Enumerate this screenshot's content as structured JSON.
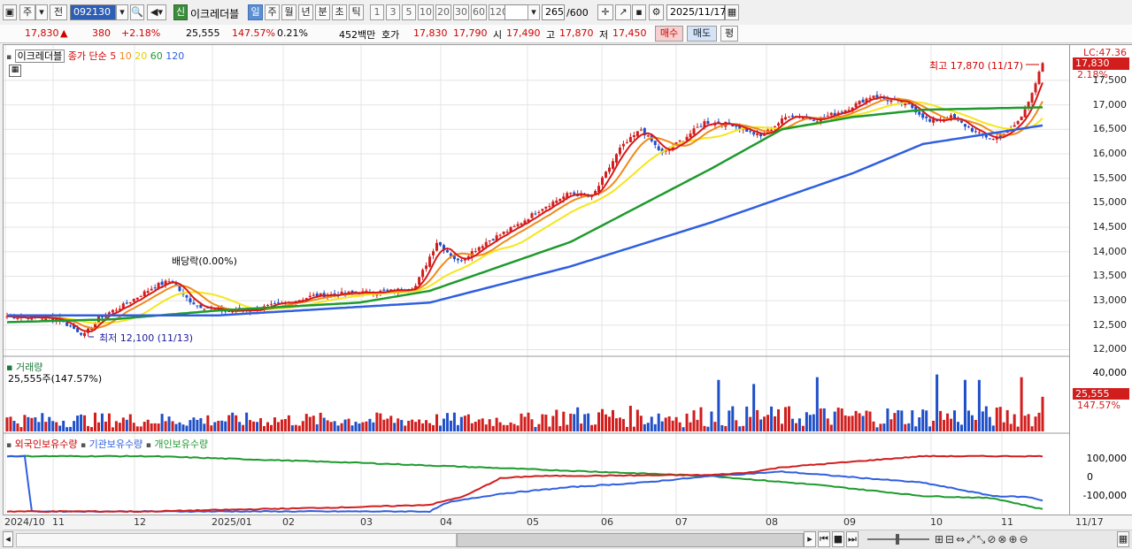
{
  "toolbar": {
    "period_day": "주",
    "prev": "전",
    "code": "092130",
    "name_tag": "신",
    "stock_name": "이크레더블",
    "tf": [
      "일",
      "주",
      "월",
      "년",
      "분",
      "초",
      "틱"
    ],
    "nums": [
      "1",
      "3",
      "5",
      "10",
      "20",
      "30",
      "60",
      "120"
    ],
    "count": "265",
    "count_max": "/600",
    "date": "2025/11/17"
  },
  "info": {
    "price": "17,830",
    "arrow": "▲",
    "change": "380",
    "pct": "+2.18%",
    "volume": "25,555",
    "vol_pct": "147.57%",
    "turn": "0.21%",
    "amount": "452백만",
    "ask_label": "호가",
    "ask": "17,830",
    "bid": "17,790",
    "open_label": "시",
    "open": "17,490",
    "high_label": "고",
    "high": "17,870",
    "low_label": "저",
    "low": "17,450",
    "buy": "매수",
    "sell": "매도",
    "eval": "평"
  },
  "price_panel": {
    "title": "이크레더블",
    "ma_label": "종가 단순",
    "mas": [
      "5",
      "10",
      "20",
      "60",
      "120"
    ],
    "lc": "LC:47.36",
    "last": "17,830",
    "last_pct": "2.18%",
    "high_note": "최고 17,870 (11/17)",
    "low_note": "최저 12,100 (11/13)",
    "div_note": "배당락(0.00%)",
    "yticks": [
      "17,500",
      "17,000",
      "16,500",
      "16,000",
      "15,500",
      "15,000",
      "14,500",
      "14,000",
      "13,500",
      "13,000",
      "12,500",
      "12,000"
    ]
  },
  "volume_panel": {
    "title": "거래량",
    "value": "25,555주(147.57%)",
    "ytick": "40,000",
    "last": "25,555",
    "last_pct": "147.57%"
  },
  "holder_panel": {
    "series": [
      "외국인보유수량",
      "기관보유수량",
      "개인보유수량"
    ],
    "yticks": [
      "100,000",
      "0",
      "-100,000"
    ]
  },
  "xaxis": {
    "labels": [
      "2024/10",
      "11",
      "12",
      "2025/01",
      "02",
      "03",
      "04",
      "05",
      "06",
      "07",
      "08",
      "09",
      "10",
      "11"
    ],
    "last": "11/17"
  },
  "colors": {
    "up": "#d21d1d",
    "down": "#1f4fc8",
    "ma5": "#d81818",
    "ma10": "#f08a1c",
    "ma20": "#f5e61a",
    "ma60": "#1e9a2e",
    "ma120": "#2f5fe0"
  },
  "chart_data": {
    "type": "candlestick",
    "ylim": [
      11900,
      17950
    ],
    "high": {
      "value": 17870,
      "date": "11/17"
    },
    "low": {
      "value": 12100,
      "date": "11/13"
    },
    "anchors_close": [
      [
        0,
        12680
      ],
      [
        14,
        12640
      ],
      [
        22,
        12300
      ],
      [
        26,
        12650
      ],
      [
        33,
        12900
      ],
      [
        42,
        13300
      ],
      [
        47,
        13420
      ],
      [
        50,
        13100
      ],
      [
        54,
        12900
      ],
      [
        62,
        12780
      ],
      [
        70,
        12820
      ],
      [
        79,
        12950
      ],
      [
        87,
        13100
      ],
      [
        97,
        13150
      ],
      [
        110,
        13200
      ],
      [
        116,
        13300
      ],
      [
        122,
        14200
      ],
      [
        128,
        13800
      ],
      [
        136,
        14200
      ],
      [
        144,
        14500
      ],
      [
        152,
        14900
      ],
      [
        160,
        15200
      ],
      [
        166,
        15100
      ],
      [
        174,
        16100
      ],
      [
        180,
        16500
      ],
      [
        186,
        16000
      ],
      [
        192,
        16300
      ],
      [
        198,
        16650
      ],
      [
        206,
        16600
      ],
      [
        214,
        16350
      ],
      [
        222,
        16800
      ],
      [
        230,
        16700
      ],
      [
        238,
        16900
      ],
      [
        246,
        17200
      ],
      [
        250,
        17100
      ],
      [
        256,
        17000
      ],
      [
        262,
        16650
      ],
      [
        268,
        16750
      ],
      [
        276,
        16400
      ],
      [
        280,
        16300
      ],
      [
        285,
        16500
      ],
      [
        288,
        16750
      ],
      [
        292,
        17450
      ],
      [
        294,
        17830
      ]
    ],
    "ma60_anchors": [
      [
        0,
        12560
      ],
      [
        30,
        12620
      ],
      [
        60,
        12800
      ],
      [
        100,
        12960
      ],
      [
        120,
        13200
      ],
      [
        160,
        14200
      ],
      [
        200,
        15700
      ],
      [
        220,
        16500
      ],
      [
        240,
        16750
      ],
      [
        260,
        16900
      ],
      [
        294,
        16950
      ]
    ],
    "ma120_anchors": [
      [
        0,
        12700
      ],
      [
        60,
        12700
      ],
      [
        120,
        12960
      ],
      [
        160,
        13700
      ],
      [
        200,
        14600
      ],
      [
        240,
        15600
      ],
      [
        260,
        16200
      ],
      [
        294,
        16580
      ]
    ],
    "volume_ylim": [
      0,
      45000
    ],
    "volume_spikes": [
      [
        202,
        38000
      ],
      [
        212,
        35000
      ],
      [
        230,
        40000
      ],
      [
        264,
        42000
      ],
      [
        272,
        38000
      ],
      [
        276,
        38000
      ],
      [
        288,
        40000
      ],
      [
        294,
        25555
      ]
    ],
    "holders": {
      "ylim": [
        -150000,
        150000
      ],
      "foreign": [
        [
          0,
          -140000
        ],
        [
          40,
          -140000
        ],
        [
          100,
          -120000
        ],
        [
          120,
          -110000
        ],
        [
          130,
          -70000
        ],
        [
          140,
          10000
        ],
        [
          150,
          20000
        ],
        [
          200,
          25000
        ],
        [
          210,
          35000
        ],
        [
          220,
          60000
        ],
        [
          260,
          110000
        ],
        [
          294,
          110000
        ]
      ],
      "institution": [
        [
          0,
          110000
        ],
        [
          5,
          110000
        ],
        [
          7,
          -140000
        ],
        [
          40,
          -140000
        ],
        [
          120,
          -140000
        ],
        [
          125,
          -100000
        ],
        [
          140,
          -60000
        ],
        [
          160,
          -30000
        ],
        [
          180,
          -10000
        ],
        [
          200,
          20000
        ],
        [
          220,
          40000
        ],
        [
          260,
          -10000
        ],
        [
          280,
          -70000
        ],
        [
          290,
          -75000
        ],
        [
          294,
          -90000
        ]
      ],
      "individual": [
        [
          0,
          110000
        ],
        [
          40,
          110000
        ],
        [
          100,
          80000
        ],
        [
          150,
          50000
        ],
        [
          200,
          20000
        ],
        [
          230,
          -20000
        ],
        [
          260,
          -70000
        ],
        [
          280,
          -80000
        ],
        [
          294,
          -130000
        ]
      ]
    }
  }
}
